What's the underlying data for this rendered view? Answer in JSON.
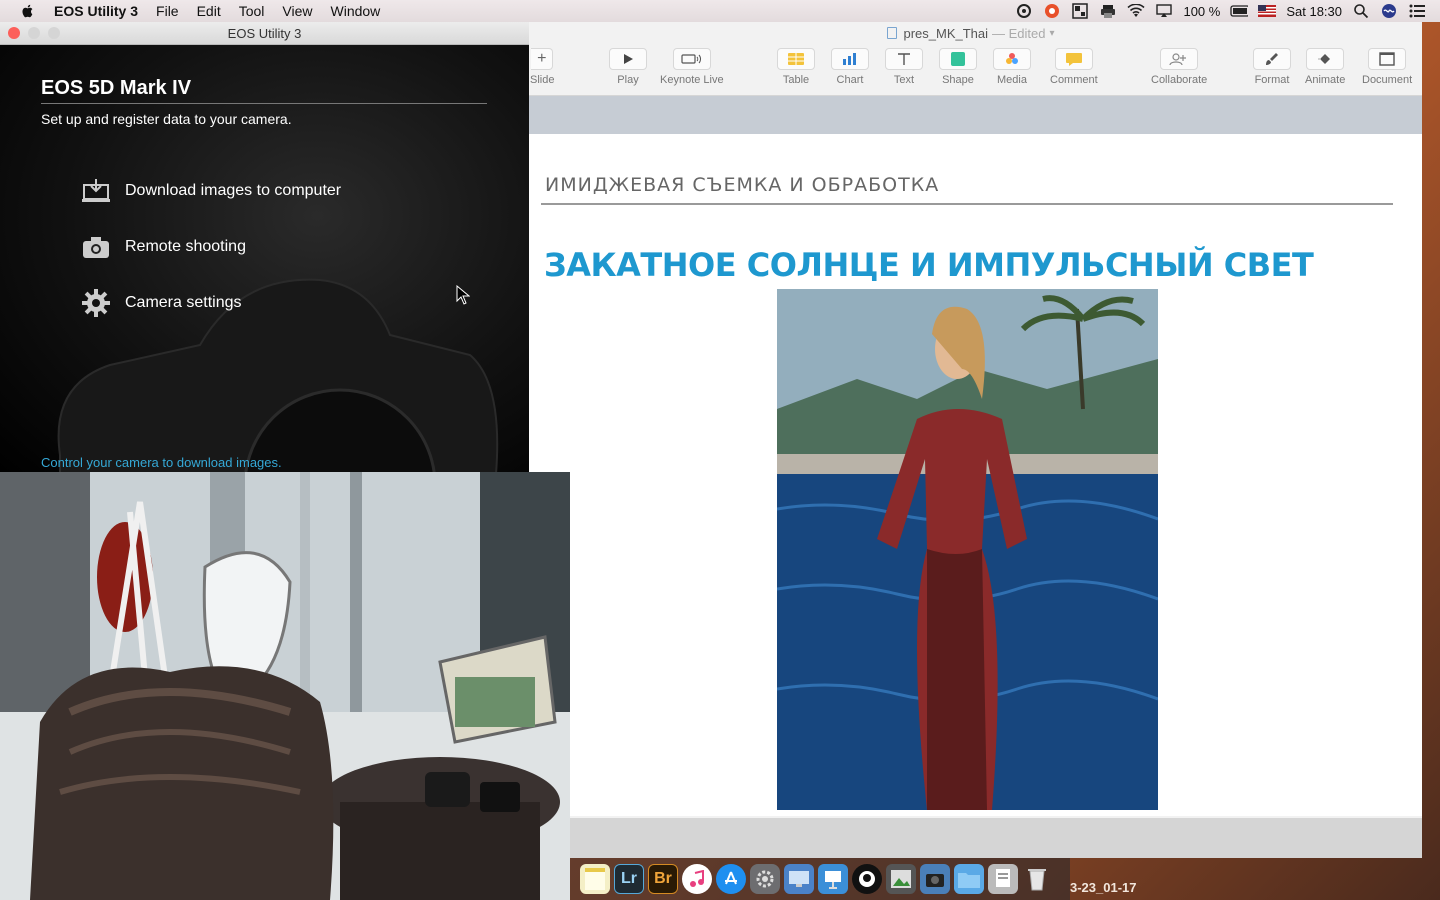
{
  "menubar": {
    "app_name": "EOS Utility 3",
    "menus": [
      "File",
      "Edit",
      "Tool",
      "View",
      "Window"
    ],
    "battery": "100 %",
    "clock": "Sat 18:30"
  },
  "eos_window": {
    "title": "EOS Utility 3",
    "camera_model": "EOS 5D Mark IV",
    "subtitle": "Set up and register data to your camera.",
    "items": [
      {
        "label": "Download images to computer",
        "icon": "download-icon"
      },
      {
        "label": "Remote shooting",
        "icon": "camera-icon"
      },
      {
        "label": "Camera settings",
        "icon": "gear-icon"
      }
    ],
    "footer": "Control your camera to download images."
  },
  "keynote": {
    "doc_title": "pres_MK_Thai",
    "edited": "— Edited",
    "toolbar": {
      "slide": "Slide",
      "play": "Play",
      "keynote_live": "Keynote Live",
      "table": "Table",
      "chart": "Chart",
      "text": "Text",
      "shape": "Shape",
      "media": "Media",
      "comment": "Comment",
      "collaborate": "Collaborate",
      "format": "Format",
      "animate": "Animate",
      "document": "Document"
    },
    "slide": {
      "subtitle": "ИМИДЖЕВАЯ СЪЕМКА И ОБРАБОТКА",
      "headline": "ЗАКАТНОЕ СОЛНЦЕ И ИМПУЛЬСНЫЙ СВЕТ"
    }
  },
  "dock": {
    "apps": [
      "Notes",
      "Lr",
      "Br",
      "iTunes",
      "App Store",
      "System Preferences",
      "Finder",
      "Preview",
      "Trash"
    ]
  },
  "desktop": {
    "file_label": "3-23_01-17"
  },
  "colors": {
    "headline": "#1e98cf",
    "eos_footer": "#35a8d6"
  }
}
